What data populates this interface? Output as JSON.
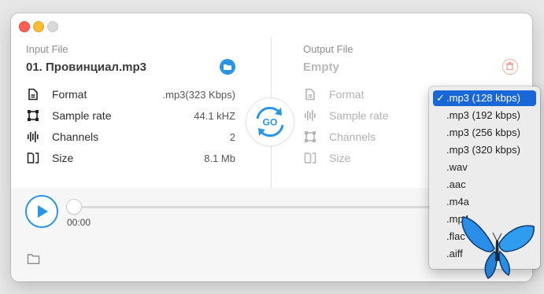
{
  "window": {
    "traffic_lights": [
      "close",
      "minimize",
      "zoom"
    ]
  },
  "input": {
    "label": "Input File",
    "filename": "01. Провинциал.mp3",
    "rows": [
      {
        "label": "Format",
        "value": ".mp3(323 Kbps)",
        "icon": "document-icon"
      },
      {
        "label": "Sample rate",
        "value": "44.1 kHZ",
        "icon": "sample-rate-icon"
      },
      {
        "label": "Channels",
        "value": "2",
        "icon": "waveform-icon"
      },
      {
        "label": "Size",
        "value": "8.1 Mb",
        "icon": "file-size-icon"
      }
    ]
  },
  "go_button": {
    "label": "GO"
  },
  "output": {
    "label": "Output File",
    "filename": "Empty",
    "rows": [
      {
        "label": "Format",
        "icon": "document-icon"
      },
      {
        "label": "Sample rate",
        "icon": "waveform-icon"
      },
      {
        "label": "Channels",
        "icon": "sample-rate-icon"
      },
      {
        "label": "Size",
        "icon": "file-size-icon"
      }
    ]
  },
  "player": {
    "time": "00:00",
    "progress": 0
  },
  "format_menu": {
    "selected_index": 0,
    "options": [
      ".mp3 (128 kbps)",
      ".mp3 (192 kbps)",
      ".mp3 (256 kbps)",
      ".mp3 (320 kbps)",
      ".wav",
      ".aac",
      ".m4a",
      ".mp4",
      ".flac",
      ".aiff"
    ]
  },
  "colors": {
    "accent": "#2a95e6",
    "selection": "#1966d6",
    "delete": "#f0a090"
  }
}
